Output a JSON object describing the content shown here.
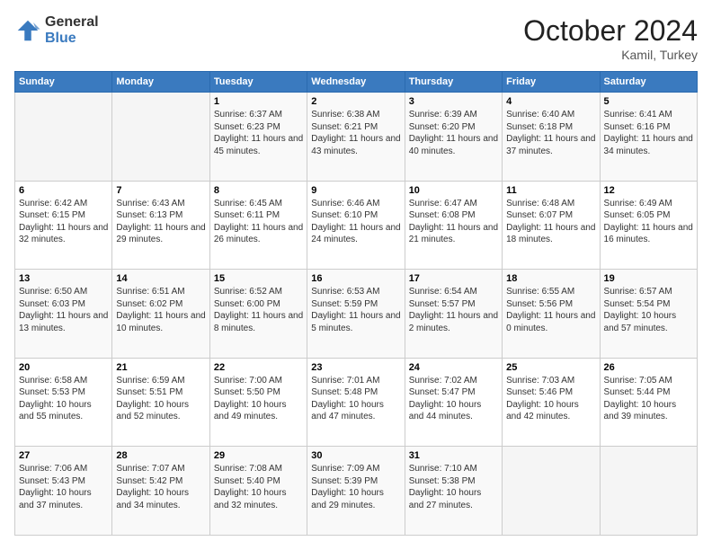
{
  "logo": {
    "general": "General",
    "blue": "Blue"
  },
  "header": {
    "month": "October 2024",
    "location": "Kamil, Turkey"
  },
  "weekdays": [
    "Sunday",
    "Monday",
    "Tuesday",
    "Wednesday",
    "Thursday",
    "Friday",
    "Saturday"
  ],
  "weeks": [
    [
      {
        "day": "",
        "sunrise": "",
        "sunset": "",
        "daylight": ""
      },
      {
        "day": "",
        "sunrise": "",
        "sunset": "",
        "daylight": ""
      },
      {
        "day": "1",
        "sunrise": "Sunrise: 6:37 AM",
        "sunset": "Sunset: 6:23 PM",
        "daylight": "Daylight: 11 hours and 45 minutes."
      },
      {
        "day": "2",
        "sunrise": "Sunrise: 6:38 AM",
        "sunset": "Sunset: 6:21 PM",
        "daylight": "Daylight: 11 hours and 43 minutes."
      },
      {
        "day": "3",
        "sunrise": "Sunrise: 6:39 AM",
        "sunset": "Sunset: 6:20 PM",
        "daylight": "Daylight: 11 hours and 40 minutes."
      },
      {
        "day": "4",
        "sunrise": "Sunrise: 6:40 AM",
        "sunset": "Sunset: 6:18 PM",
        "daylight": "Daylight: 11 hours and 37 minutes."
      },
      {
        "day": "5",
        "sunrise": "Sunrise: 6:41 AM",
        "sunset": "Sunset: 6:16 PM",
        "daylight": "Daylight: 11 hours and 34 minutes."
      }
    ],
    [
      {
        "day": "6",
        "sunrise": "Sunrise: 6:42 AM",
        "sunset": "Sunset: 6:15 PM",
        "daylight": "Daylight: 11 hours and 32 minutes."
      },
      {
        "day": "7",
        "sunrise": "Sunrise: 6:43 AM",
        "sunset": "Sunset: 6:13 PM",
        "daylight": "Daylight: 11 hours and 29 minutes."
      },
      {
        "day": "8",
        "sunrise": "Sunrise: 6:45 AM",
        "sunset": "Sunset: 6:11 PM",
        "daylight": "Daylight: 11 hours and 26 minutes."
      },
      {
        "day": "9",
        "sunrise": "Sunrise: 6:46 AM",
        "sunset": "Sunset: 6:10 PM",
        "daylight": "Daylight: 11 hours and 24 minutes."
      },
      {
        "day": "10",
        "sunrise": "Sunrise: 6:47 AM",
        "sunset": "Sunset: 6:08 PM",
        "daylight": "Daylight: 11 hours and 21 minutes."
      },
      {
        "day": "11",
        "sunrise": "Sunrise: 6:48 AM",
        "sunset": "Sunset: 6:07 PM",
        "daylight": "Daylight: 11 hours and 18 minutes."
      },
      {
        "day": "12",
        "sunrise": "Sunrise: 6:49 AM",
        "sunset": "Sunset: 6:05 PM",
        "daylight": "Daylight: 11 hours and 16 minutes."
      }
    ],
    [
      {
        "day": "13",
        "sunrise": "Sunrise: 6:50 AM",
        "sunset": "Sunset: 6:03 PM",
        "daylight": "Daylight: 11 hours and 13 minutes."
      },
      {
        "day": "14",
        "sunrise": "Sunrise: 6:51 AM",
        "sunset": "Sunset: 6:02 PM",
        "daylight": "Daylight: 11 hours and 10 minutes."
      },
      {
        "day": "15",
        "sunrise": "Sunrise: 6:52 AM",
        "sunset": "Sunset: 6:00 PM",
        "daylight": "Daylight: 11 hours and 8 minutes."
      },
      {
        "day": "16",
        "sunrise": "Sunrise: 6:53 AM",
        "sunset": "Sunset: 5:59 PM",
        "daylight": "Daylight: 11 hours and 5 minutes."
      },
      {
        "day": "17",
        "sunrise": "Sunrise: 6:54 AM",
        "sunset": "Sunset: 5:57 PM",
        "daylight": "Daylight: 11 hours and 2 minutes."
      },
      {
        "day": "18",
        "sunrise": "Sunrise: 6:55 AM",
        "sunset": "Sunset: 5:56 PM",
        "daylight": "Daylight: 11 hours and 0 minutes."
      },
      {
        "day": "19",
        "sunrise": "Sunrise: 6:57 AM",
        "sunset": "Sunset: 5:54 PM",
        "daylight": "Daylight: 10 hours and 57 minutes."
      }
    ],
    [
      {
        "day": "20",
        "sunrise": "Sunrise: 6:58 AM",
        "sunset": "Sunset: 5:53 PM",
        "daylight": "Daylight: 10 hours and 55 minutes."
      },
      {
        "day": "21",
        "sunrise": "Sunrise: 6:59 AM",
        "sunset": "Sunset: 5:51 PM",
        "daylight": "Daylight: 10 hours and 52 minutes."
      },
      {
        "day": "22",
        "sunrise": "Sunrise: 7:00 AM",
        "sunset": "Sunset: 5:50 PM",
        "daylight": "Daylight: 10 hours and 49 minutes."
      },
      {
        "day": "23",
        "sunrise": "Sunrise: 7:01 AM",
        "sunset": "Sunset: 5:48 PM",
        "daylight": "Daylight: 10 hours and 47 minutes."
      },
      {
        "day": "24",
        "sunrise": "Sunrise: 7:02 AM",
        "sunset": "Sunset: 5:47 PM",
        "daylight": "Daylight: 10 hours and 44 minutes."
      },
      {
        "day": "25",
        "sunrise": "Sunrise: 7:03 AM",
        "sunset": "Sunset: 5:46 PM",
        "daylight": "Daylight: 10 hours and 42 minutes."
      },
      {
        "day": "26",
        "sunrise": "Sunrise: 7:05 AM",
        "sunset": "Sunset: 5:44 PM",
        "daylight": "Daylight: 10 hours and 39 minutes."
      }
    ],
    [
      {
        "day": "27",
        "sunrise": "Sunrise: 7:06 AM",
        "sunset": "Sunset: 5:43 PM",
        "daylight": "Daylight: 10 hours and 37 minutes."
      },
      {
        "day": "28",
        "sunrise": "Sunrise: 7:07 AM",
        "sunset": "Sunset: 5:42 PM",
        "daylight": "Daylight: 10 hours and 34 minutes."
      },
      {
        "day": "29",
        "sunrise": "Sunrise: 7:08 AM",
        "sunset": "Sunset: 5:40 PM",
        "daylight": "Daylight: 10 hours and 32 minutes."
      },
      {
        "day": "30",
        "sunrise": "Sunrise: 7:09 AM",
        "sunset": "Sunset: 5:39 PM",
        "daylight": "Daylight: 10 hours and 29 minutes."
      },
      {
        "day": "31",
        "sunrise": "Sunrise: 7:10 AM",
        "sunset": "Sunset: 5:38 PM",
        "daylight": "Daylight: 10 hours and 27 minutes."
      },
      {
        "day": "",
        "sunrise": "",
        "sunset": "",
        "daylight": ""
      },
      {
        "day": "",
        "sunrise": "",
        "sunset": "",
        "daylight": ""
      }
    ]
  ]
}
